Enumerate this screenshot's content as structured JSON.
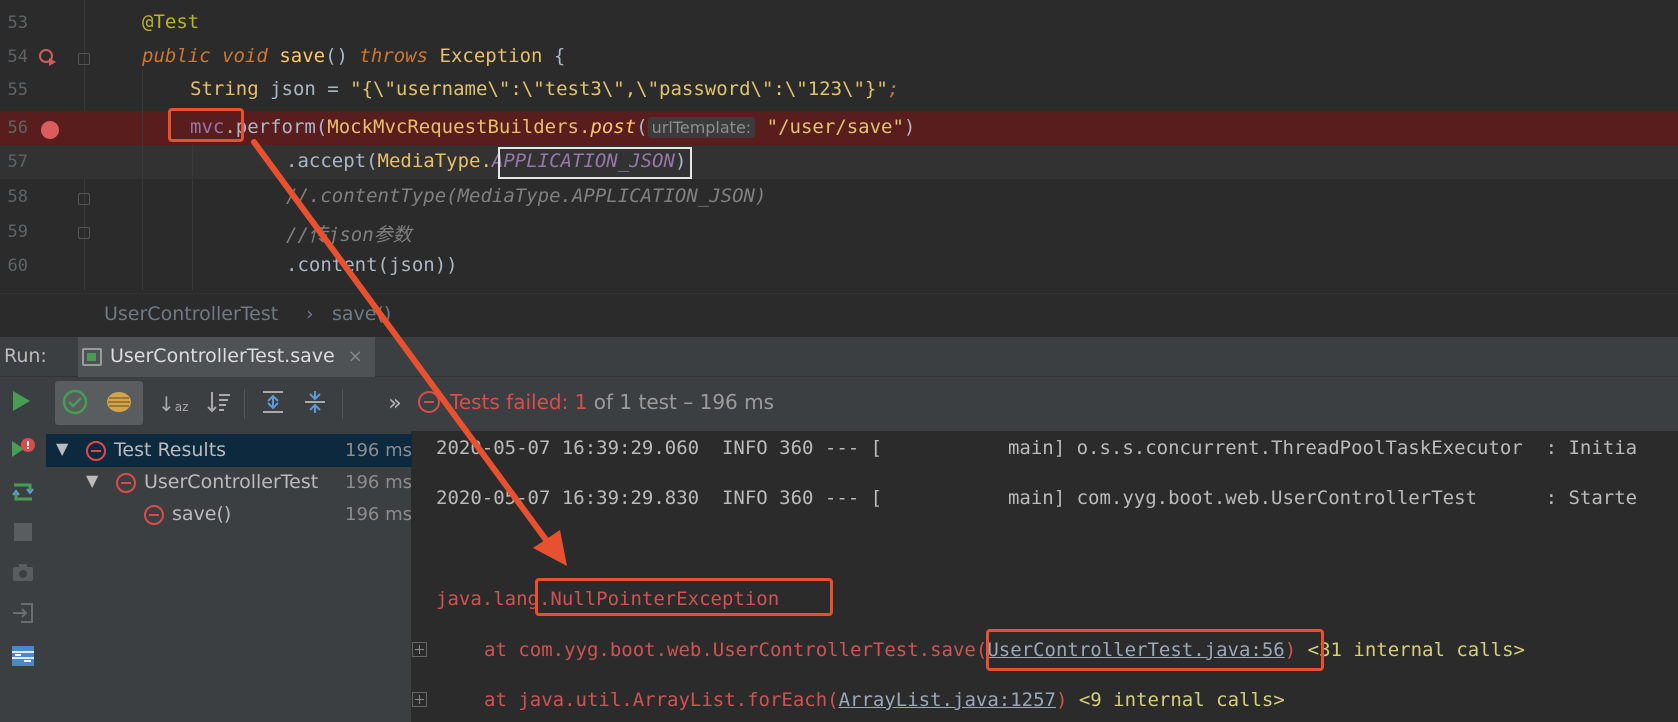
{
  "editor": {
    "lines": [
      {
        "num": "53"
      },
      {
        "num": "54"
      },
      {
        "num": "55"
      },
      {
        "num": "56"
      },
      {
        "num": "57"
      },
      {
        "num": "58"
      },
      {
        "num": "59"
      },
      {
        "num": "60"
      }
    ],
    "code": {
      "l53_annot": "@Test",
      "l54_public": "public",
      "l54_void": "void",
      "l54_method": "save",
      "l54_parens": "()",
      "l54_throws": "throws",
      "l54_exception": "Exception",
      "l54_brace": "{",
      "l55_type": "String",
      "l55_rest": "json = ",
      "l55_str": "\"{\\\"username\\\":\\\"test3\\\",\\\"password\\\":\\\"123\\\"}\"",
      "l55_semi": ";",
      "l56_mvc": "mvc",
      "l56_dot": ".",
      "l56_perform": "perform(",
      "l56_builders": "MockMvcRequestBuilders.",
      "l56_post": "post",
      "l56_paren": "(",
      "l56_hint": "urlTemplate:",
      "l56_str": "\"/user/save\"",
      "l56_close": ")",
      "l57_accept": ".accept(",
      "l57_mediatype": "MediaType.",
      "l57_const": "APPLICATION_JSON",
      "l57_close": ")",
      "l58_comment": "//.contentType(MediaType.APPLICATION_JSON)",
      "l59_comment": "//传json参数",
      "l60_content": ".content(json))"
    }
  },
  "breadcrumb": {
    "class_name": "UserControllerTest",
    "separator": "›",
    "method_name": "save()"
  },
  "run": {
    "label": "Run:",
    "tab_label": "UserControllerTest.save",
    "tab_close": "×",
    "summary_prefix": "Tests failed:",
    "summary_failed": "1",
    "summary_rest": "of 1 test – 196 ms",
    "more": "»"
  },
  "tree": {
    "items": [
      {
        "label": "Test Results",
        "time": "196 ms"
      },
      {
        "label": "UserControllerTest",
        "time": "196 ms"
      },
      {
        "label": "save()",
        "time": "196 ms"
      }
    ]
  },
  "console": {
    "log1": "2020-05-07 16:39:29.060  INFO 360 --- [           main] o.s.s.concurrent.ThreadPoolTaskExecutor  : Initia",
    "log2": "2020-05-07 16:39:29.830  INFO 360 --- [           main] com.yyg.boot.web.UserControllerTest      : Starte",
    "exc_prefix": "java.lang.",
    "exc_name": "NullPointerException",
    "trace1_at": "at com.yyg.boot.web.UserControllerTest.save(",
    "trace1_link": "UserControllerTest.java:56",
    "trace1_close": ")",
    "trace1_internal": "<31 internal calls>",
    "trace2_at": "at java.util.ArrayList.forEach(",
    "trace2_link": "ArrayList.java:1257",
    "trace2_close": ")",
    "trace2_internal": "<9 internal calls>"
  },
  "colors": {
    "annotation_highlight": "#e8512f",
    "breakpoint_line": "#5a1d1d",
    "fail_red": "#d94c4c"
  }
}
